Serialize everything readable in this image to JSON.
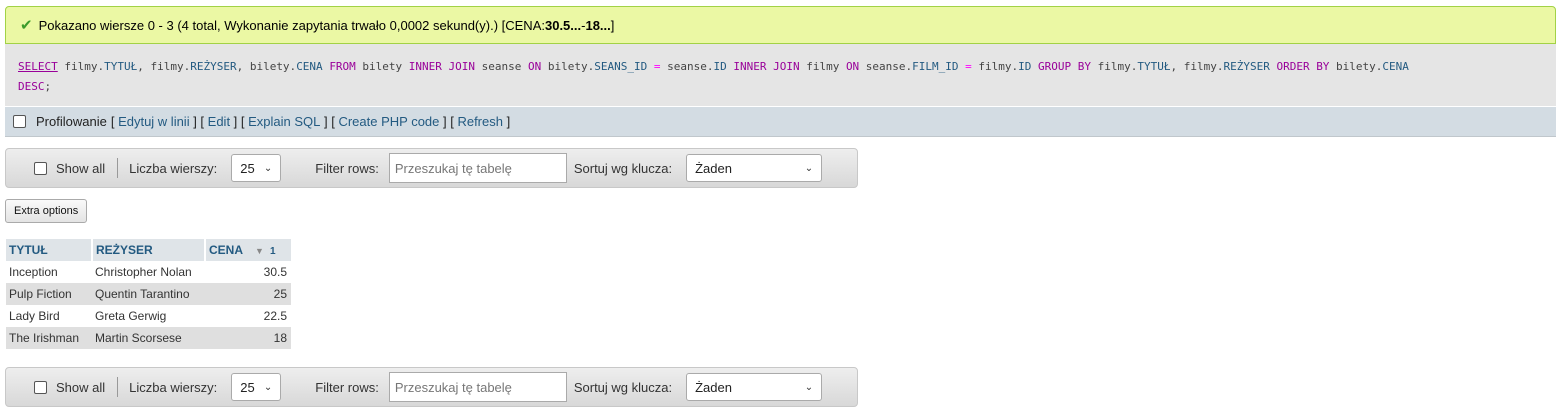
{
  "message": {
    "prefix": "Pokazano wiersze 0 - 3 (4 total, Wykonanie zapytania trwało 0,0002 sekund(y).) [CENA: ",
    "bold1": "30.5...",
    "mid": " - ",
    "bold2": "18...",
    "suffix": "]"
  },
  "sql": {
    "tokens": [
      [
        "kw-u",
        "SELECT"
      ],
      [
        "t",
        " filmy."
      ],
      [
        "col",
        "TYTUŁ"
      ],
      [
        "t",
        ", filmy."
      ],
      [
        "col",
        "REŻYSER"
      ],
      [
        "t",
        ", bilety."
      ],
      [
        "col",
        "CENA"
      ],
      [
        "t",
        " "
      ],
      [
        "kw",
        "FROM"
      ],
      [
        "t",
        " bilety "
      ],
      [
        "kw",
        "INNER JOIN"
      ],
      [
        "t",
        " seanse "
      ],
      [
        "kw",
        "ON"
      ],
      [
        "t",
        " bilety."
      ],
      [
        "col",
        "SEANS_ID"
      ],
      [
        "t",
        " "
      ],
      [
        "op",
        "="
      ],
      [
        "t",
        " seanse."
      ],
      [
        "col",
        "ID"
      ],
      [
        "t",
        " "
      ],
      [
        "kw",
        "INNER JOIN"
      ],
      [
        "t",
        " filmy "
      ],
      [
        "kw",
        "ON"
      ],
      [
        "t",
        " seanse."
      ],
      [
        "col",
        "FILM_ID"
      ],
      [
        "t",
        " "
      ],
      [
        "op",
        "="
      ],
      [
        "t",
        " filmy."
      ],
      [
        "col",
        "ID"
      ],
      [
        "t",
        " "
      ],
      [
        "kw",
        "GROUP BY"
      ],
      [
        "t",
        " filmy."
      ],
      [
        "col",
        "TYTUŁ"
      ],
      [
        "t",
        ", filmy."
      ],
      [
        "col",
        "REŻYSER"
      ],
      [
        "t",
        " "
      ],
      [
        "kw",
        "ORDER BY"
      ],
      [
        "t",
        " bilety."
      ],
      [
        "col",
        "CENA"
      ],
      [
        "br",
        ""
      ],
      [
        "kw",
        "DESC"
      ],
      [
        "t",
        ";"
      ]
    ]
  },
  "toolbar": {
    "profiling": "Profilowanie",
    "links": [
      "Edytuj w linii",
      "Edit",
      "Explain SQL",
      "Create PHP code",
      "Refresh"
    ]
  },
  "nav": {
    "show_all": "Show all",
    "rows_label": "Liczba wierszy:",
    "rows_value": "25",
    "filter_label": "Filter rows:",
    "filter_placeholder": "Przeszukaj tę tabelę",
    "sort_label": "Sortuj wg klucza:",
    "sort_value": "Żaden"
  },
  "extra_options": "Extra options",
  "table": {
    "headers": [
      "TYTUŁ",
      "REŻYSER",
      "CENA"
    ],
    "sort_index": "1",
    "rows": [
      [
        "Inception",
        "Christopher Nolan",
        "30.5"
      ],
      [
        "Pulp Fiction",
        "Quentin Tarantino",
        "25"
      ],
      [
        "Lady Bird",
        "Greta Gerwig",
        "22.5"
      ],
      [
        "The Irishman",
        "Martin Scorsese",
        "18"
      ]
    ]
  }
}
